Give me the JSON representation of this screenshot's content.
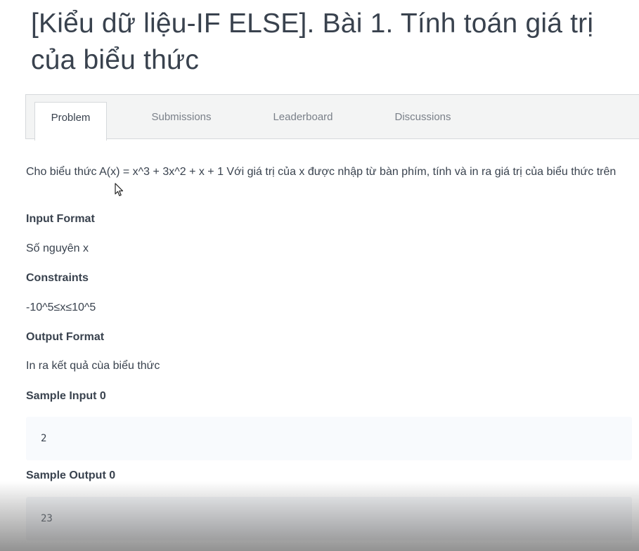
{
  "page": {
    "title": "[Kiểu dữ liệu-IF ELSE]. Bài 1. Tính toán giá trị của biểu thức"
  },
  "tabs": [
    {
      "label": "Problem",
      "active": true
    },
    {
      "label": "Submissions",
      "active": false
    },
    {
      "label": "Leaderboard",
      "active": false
    },
    {
      "label": "Discussions",
      "active": false
    }
  ],
  "problem": {
    "statement": "Cho biểu thức A(x) = x^3 + 3x^2 + x + 1 Với giá trị của x được nhập từ bàn phím, tính và in ra giá trị của biểu thức trên",
    "input_format_heading": "Input Format",
    "input_format_text": "Số nguyên x",
    "constraints_heading": "Constraints",
    "constraints_text": "-10^5≤x≤10^5",
    "output_format_heading": "Output Format",
    "output_format_text": "In ra kết quả cùa biểu thức",
    "sample_input_heading": "Sample Input 0",
    "sample_input_value": "2",
    "sample_output_heading": "Sample Output 0",
    "sample_output_value": "23"
  },
  "icons": {
    "cursor": "mouse-pointer-icon"
  }
}
